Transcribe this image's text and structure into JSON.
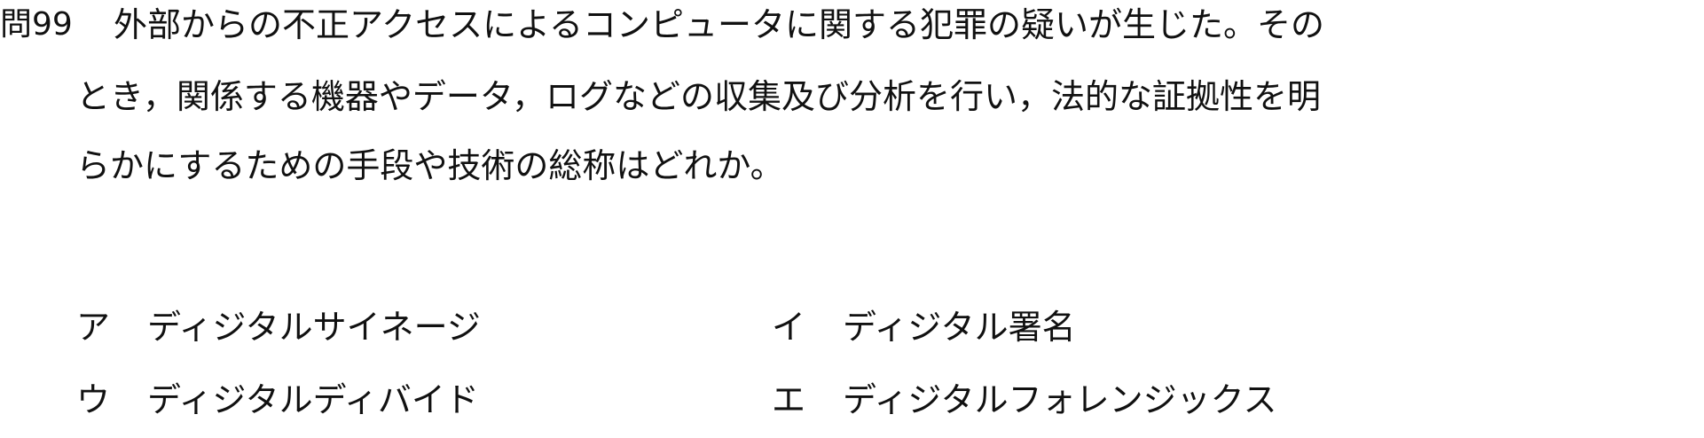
{
  "question": {
    "number": "問99",
    "lines": [
      "外部からの不正アクセスによるコンピュータに関する犯罪の疑いが生じた。その",
      "とき，関係する機器やデータ，ログなどの収集及び分析を行い，法的な証拠性を明",
      "らかにするための手段や技術の総称はどれか。"
    ]
  },
  "choices": [
    {
      "label": "ア",
      "text": "ディジタルサイネージ"
    },
    {
      "label": "イ",
      "text": "ディジタル署名"
    },
    {
      "label": "ウ",
      "text": "ディジタルディバイド"
    },
    {
      "label": "エ",
      "text": "ディジタルフォレンジックス"
    }
  ]
}
